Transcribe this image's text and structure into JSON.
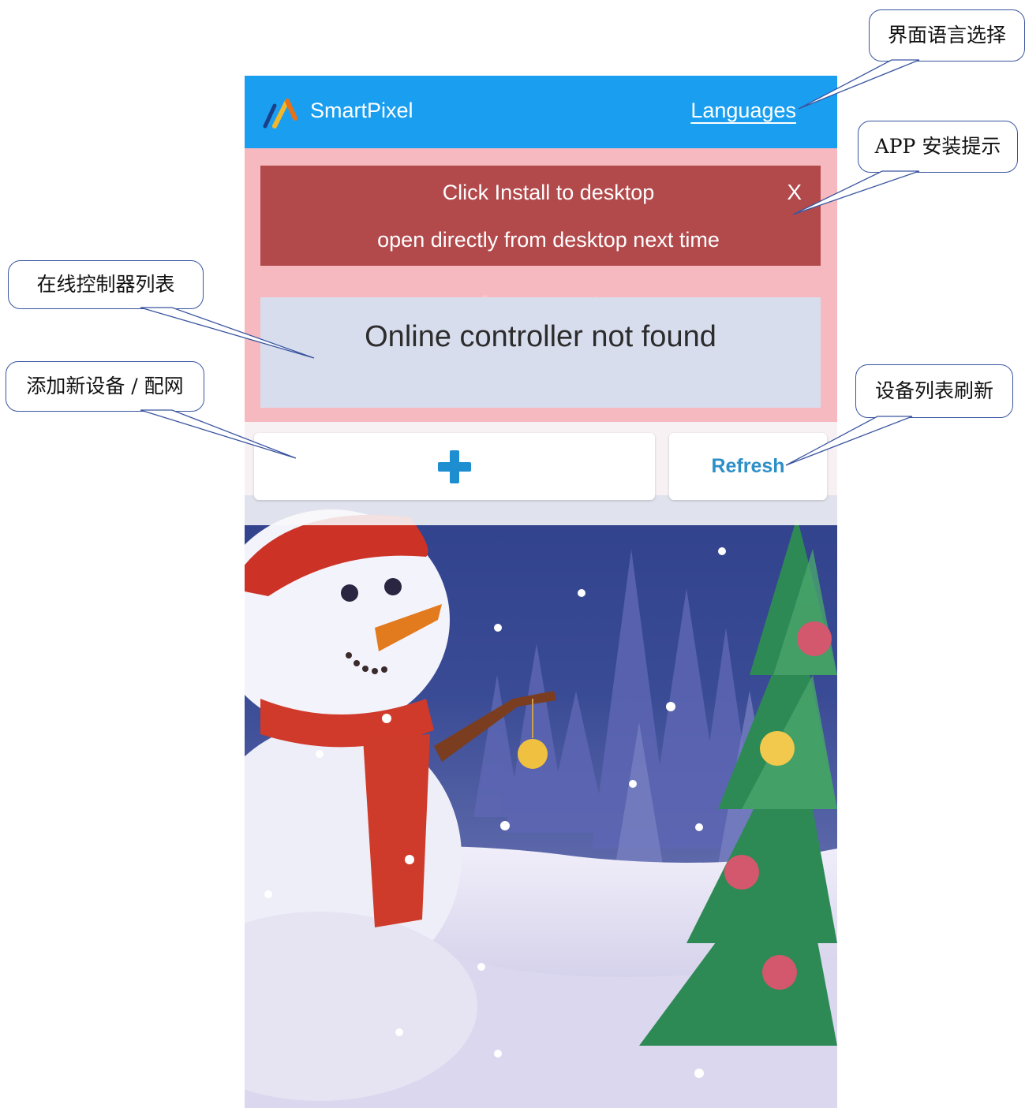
{
  "app": {
    "brand": "SmartPixel",
    "languages_link": "Languages"
  },
  "install_banner": {
    "line1": "Click Install to desktop",
    "line2": "open directly from desktop next time",
    "close": "X"
  },
  "controller_list": {
    "empty_message": "Online controller not found"
  },
  "actions": {
    "refresh_label": "Refresh"
  },
  "annotations": {
    "language_select": "界面语言选择",
    "app_install_hint": "APP 安装提示",
    "controller_list": "在线控制器列表",
    "add_device": "添加新设备 / 配网",
    "refresh_list": "设备列表刷新"
  },
  "colors": {
    "topbar": "#1a9ff0",
    "install_banner": "#b24a4c",
    "pink_panel": "#ffbec2",
    "accent_blue": "#1d8fd1"
  },
  "icons": [
    "smartpixel-logo-icon",
    "plus-icon"
  ]
}
